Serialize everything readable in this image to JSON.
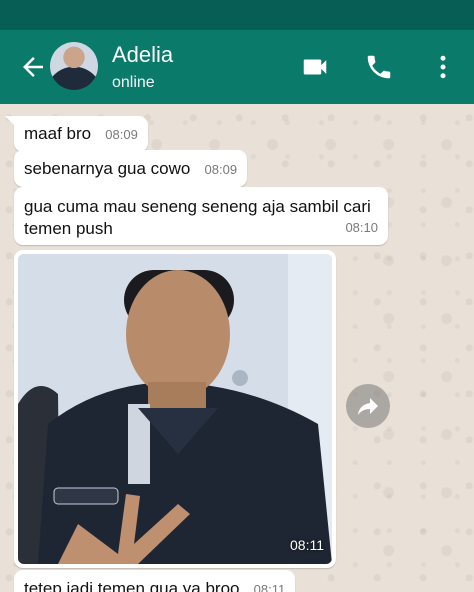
{
  "header": {
    "contact_name": "Adelia",
    "status": "online",
    "icons": [
      "back-arrow-icon",
      "video-call-icon",
      "voice-call-icon",
      "more-options-icon"
    ]
  },
  "messages": [
    {
      "text": "maaf bro",
      "time": "08:09"
    },
    {
      "text": "sebenarnya gua cowo",
      "time": "08:09"
    },
    {
      "text": "gua cuma mau seneng seneng aja sambil cari temen push",
      "time": "08:10"
    },
    {
      "type": "image",
      "time": "08:11"
    },
    {
      "text": "tetep jadi temen gua ya broo",
      "time": "08:11"
    }
  ],
  "colors": {
    "header_bg": "#0a7a6b",
    "status_bar": "#075e54",
    "chat_bg": "#e9e1d8",
    "bubble": "#ffffff"
  }
}
